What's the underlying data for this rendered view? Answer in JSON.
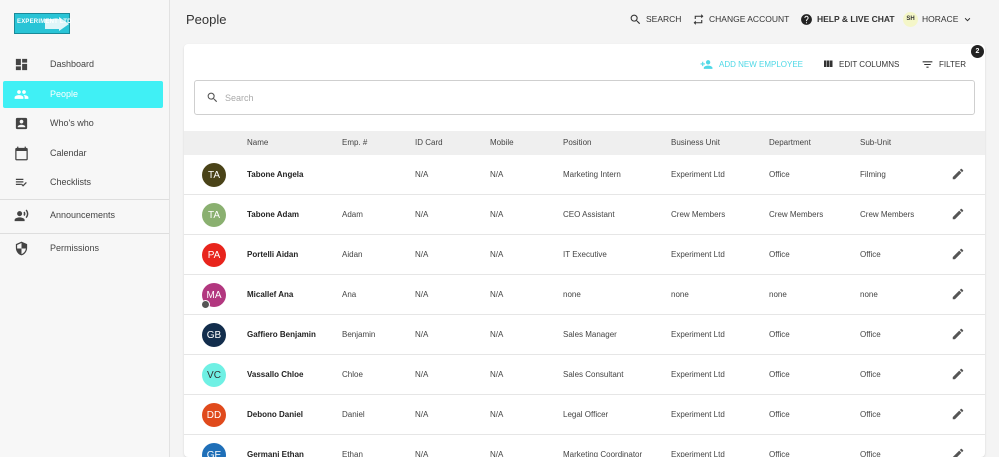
{
  "app": {
    "logo_text": "EXPERIMENT LTD",
    "page_title": "People"
  },
  "top_actions": {
    "search": "SEARCH",
    "change_account": "CHANGE ACCOUNT",
    "help": "HELP & LIVE CHAT",
    "user_initials": "SH",
    "user_name": "HORACE"
  },
  "sidebar": {
    "items": [
      {
        "label": "Dashboard",
        "icon": "dashboard-icon"
      },
      {
        "label": "People",
        "icon": "people-icon",
        "active": true
      },
      {
        "label": "Who's who",
        "icon": "contact-card-icon"
      },
      {
        "label": "Calendar",
        "icon": "calendar-icon"
      },
      {
        "label": "Checklists",
        "icon": "checklist-icon"
      },
      {
        "label": "Announcements",
        "icon": "announcement-icon"
      },
      {
        "label": "Permissions",
        "icon": "shield-icon"
      }
    ]
  },
  "toolbar": {
    "add_employee": "ADD NEW EMPLOYEE",
    "edit_columns": "EDIT COLUMNS",
    "filter": "FILTER",
    "filter_count": "2"
  },
  "search": {
    "placeholder": "Search"
  },
  "table": {
    "columns": [
      "Name",
      "Emp. #",
      "ID Card",
      "Mobile",
      "Position",
      "Business Unit",
      "Department",
      "Sub-Unit"
    ],
    "rows": [
      {
        "initials": "TA",
        "avatar_color": "#4a4318",
        "name": "Tabone Angela",
        "emp": "",
        "id_card": "N/A",
        "mobile": "N/A",
        "position": "Marketing Intern",
        "business_unit": "Experiment Ltd",
        "department": "Office",
        "sub_unit": "Filming"
      },
      {
        "initials": "TA",
        "avatar_color": "#8ab070",
        "name": "Tabone Adam",
        "emp": "Adam",
        "id_card": "N/A",
        "mobile": "N/A",
        "position": "CEO Assistant",
        "business_unit": "Crew Members",
        "department": "Crew Members",
        "sub_unit": "Crew Members"
      },
      {
        "initials": "PA",
        "avatar_color": "#e8241c",
        "name": "Portelli Aidan",
        "emp": "Aidan",
        "id_card": "N/A",
        "mobile": "N/A",
        "position": "IT Executive",
        "business_unit": "Experiment Ltd",
        "department": "Office",
        "sub_unit": "Office"
      },
      {
        "initials": "MA",
        "avatar_color": "#b2377f",
        "name": "Micallef Ana",
        "emp": "Ana",
        "id_card": "N/A",
        "mobile": "N/A",
        "position": "none",
        "business_unit": "none",
        "department": "none",
        "sub_unit": "none"
      },
      {
        "initials": "GB",
        "avatar_color": "#122d4c",
        "name": "Gaffiero Benjamin",
        "emp": "Benjamin",
        "id_card": "N/A",
        "mobile": "N/A",
        "position": "Sales Manager",
        "business_unit": "Experiment Ltd",
        "department": "Office",
        "sub_unit": "Office"
      },
      {
        "initials": "VC",
        "avatar_color": "#6ff0e4",
        "name": "Vassallo Chloe",
        "emp": "Chloe",
        "id_card": "N/A",
        "mobile": "N/A",
        "position": "Sales Consultant",
        "business_unit": "Experiment Ltd",
        "department": "Office",
        "sub_unit": "Office"
      },
      {
        "initials": "DD",
        "avatar_color": "#e04a1c",
        "name": "Debono Daniel",
        "emp": "Daniel",
        "id_card": "N/A",
        "mobile": "N/A",
        "position": "Legal Officer",
        "business_unit": "Experiment Ltd",
        "department": "Office",
        "sub_unit": "Office"
      },
      {
        "initials": "GE",
        "avatar_color": "#1f6fb8",
        "name": "Germani Ethan",
        "emp": "Ethan",
        "id_card": "N/A",
        "mobile": "N/A",
        "position": "Marketing Coordinator",
        "business_unit": "Experiment Ltd",
        "department": "Office",
        "sub_unit": "Office"
      }
    ]
  },
  "colors": {
    "accent": "#40f0f5",
    "add_employee": "#4fd8e6"
  }
}
